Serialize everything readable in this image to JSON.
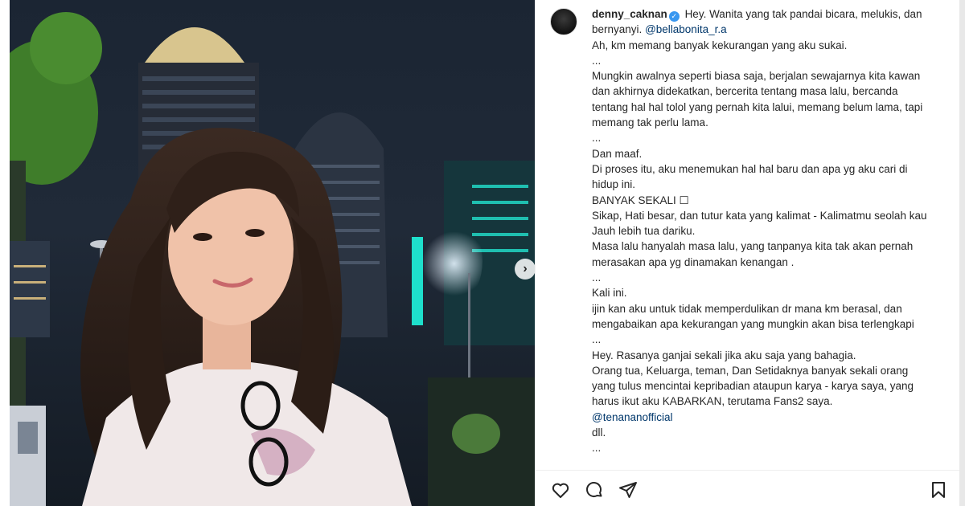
{
  "post": {
    "username": "denny_caknan",
    "verified_glyph": "✓",
    "first_line": "Hey. Wanita yang tak pandai bicara, melukis, dan bernyanyi.",
    "first_mention": "@bellabonita_r.a",
    "lines": [
      "Ah, km memang banyak kekurangan yang aku sukai.",
      "...",
      "Mungkin awalnya seperti biasa saja, berjalan sewajarnya kita kawan dan akhirnya didekatkan, bercerita tentang masa lalu, bercanda tentang hal hal tolol yang pernah kita lalui, memang belum lama, tapi memang tak perlu lama.",
      "...",
      "Dan maaf.",
      "Di proses itu, aku menemukan hal hal baru dan apa yg aku cari di hidup ini.",
      "BANYAK SEKALI ☐",
      "Sikap, Hati besar, dan tutur kata yang kalimat - Kalimatmu seolah kau Jauh lebih tua dariku.",
      "Masa lalu hanyalah masa lalu, yang tanpanya kita tak akan pernah merasakan apa yg dinamakan kenangan .",
      "...",
      "Kali ini.",
      "ijin kan aku untuk tidak memperdulikan dr mana km berasal, dan mengabaikan apa kekurangan yang mungkin akan bisa terlengkapi",
      "...",
      "Hey. Rasanya ganjai sekali jika aku saja yang bahagia.",
      "Orang tua, Keluarga, teman, Dan Setidaknya banyak sekali orang yang tulus mencintai kepribadian  ataupun karya - karya saya, yang harus ikut aku KABARKAN, terutama Fans2 saya."
    ],
    "second_mention": "@tenananofficial",
    "tail_lines": [
      "dll.",
      "..."
    ]
  },
  "carousel": {
    "next_glyph": "›"
  },
  "actions": {
    "like_icon": "heart-icon",
    "comment_icon": "comment-icon",
    "share_icon": "send-icon",
    "save_icon": "bookmark-icon"
  },
  "colors": {
    "accent": "#3897f0",
    "mention": "#00376b",
    "text": "#262626"
  }
}
